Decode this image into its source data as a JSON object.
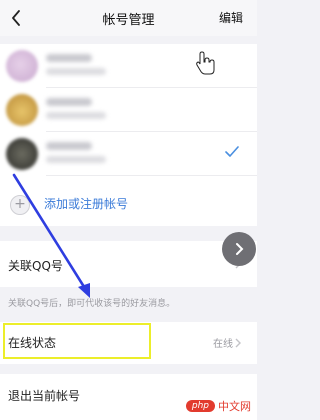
{
  "header": {
    "title": "帐号管理",
    "edit_label": "编辑",
    "back_icon": "chevron-left-icon"
  },
  "accounts": {
    "add_label": "添加或注册帐号",
    "selected_icon": "checkmark-icon",
    "accent": "#3b7bd8"
  },
  "qq_link": {
    "label": "关联QQ号",
    "description": "关联QQ号后，即可代收该号的好友消息。"
  },
  "online_status": {
    "label": "在线状态",
    "value": "在线",
    "highlight_color": "#ecee2a"
  },
  "logout": {
    "label": "退出当前帐号"
  },
  "watermark": {
    "badge": "php",
    "text": "中文网"
  }
}
